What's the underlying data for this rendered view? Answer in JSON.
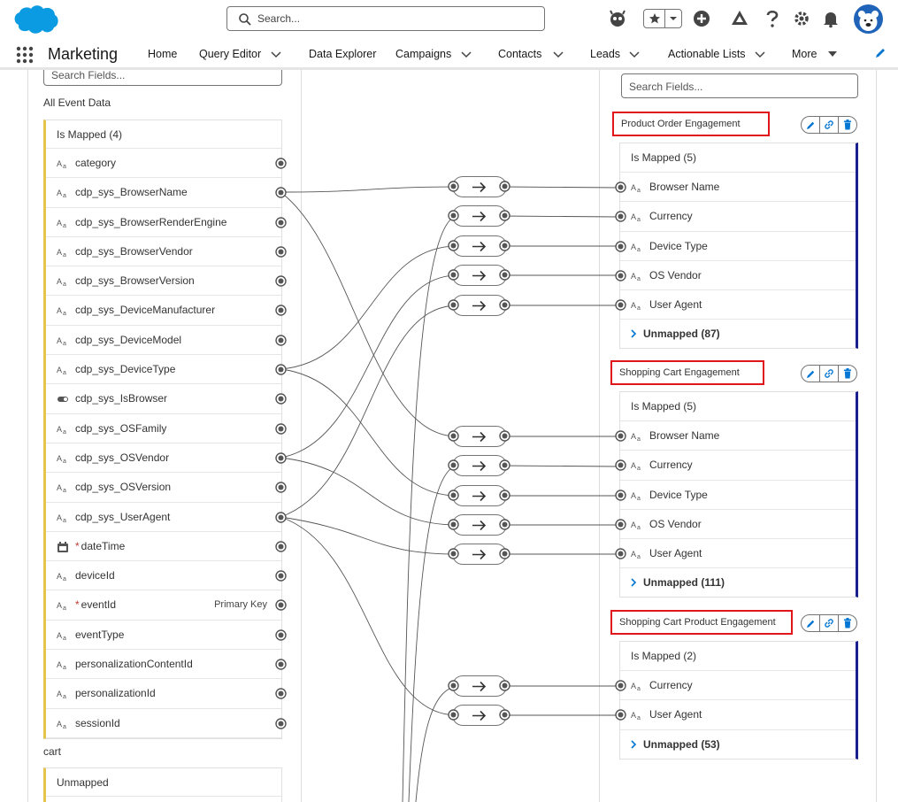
{
  "header": {
    "search_placeholder": "Search...",
    "brand_color": "#0b9be3"
  },
  "nav": {
    "app_name": "Marketing",
    "items": [
      {
        "label": "Home",
        "dropdown": false
      },
      {
        "label": "Query Editor",
        "dropdown": true
      },
      {
        "label": "Data Explorer",
        "dropdown": false
      },
      {
        "label": "Campaigns",
        "dropdown": true
      },
      {
        "label": "Contacts",
        "dropdown": true
      },
      {
        "label": "Leads",
        "dropdown": true
      },
      {
        "label": "Actionable Lists",
        "dropdown": true
      },
      {
        "label": "More",
        "dropdown": true
      }
    ]
  },
  "left": {
    "search_placeholder": "Search Fields...",
    "section_title": "All Event Data",
    "group_label": "Is Mapped (4)",
    "fields": [
      {
        "label": "category",
        "type": "text"
      },
      {
        "label": "cdp_sys_BrowserName",
        "type": "text"
      },
      {
        "label": "cdp_sys_BrowserRenderEngine",
        "type": "text"
      },
      {
        "label": "cdp_sys_BrowserVendor",
        "type": "text"
      },
      {
        "label": "cdp_sys_BrowserVersion",
        "type": "text"
      },
      {
        "label": "cdp_sys_DeviceManufacturer",
        "type": "text"
      },
      {
        "label": "cdp_sys_DeviceModel",
        "type": "text"
      },
      {
        "label": "cdp_sys_DeviceType",
        "type": "text"
      },
      {
        "label": "cdp_sys_IsBrowser",
        "type": "boolean"
      },
      {
        "label": "cdp_sys_OSFamily",
        "type": "text"
      },
      {
        "label": "cdp_sys_OSVendor",
        "type": "text"
      },
      {
        "label": "cdp_sys_OSVersion",
        "type": "text"
      },
      {
        "label": "cdp_sys_UserAgent",
        "type": "text"
      },
      {
        "label": "dateTime",
        "type": "date",
        "required": "*"
      },
      {
        "label": "deviceId",
        "type": "text"
      },
      {
        "label": "eventId",
        "type": "text",
        "required": "*",
        "badge": "Primary Key"
      },
      {
        "label": "eventType",
        "type": "text"
      },
      {
        "label": "personalizationContentId",
        "type": "text"
      },
      {
        "label": "personalizationId",
        "type": "text"
      },
      {
        "label": "sessionId",
        "type": "text"
      }
    ],
    "cart_section_title": "cart",
    "cart_group_label": "Unmapped"
  },
  "right": {
    "search_placeholder": "Search Fields...",
    "objects": [
      {
        "title": "Product Order Engagement",
        "mapped_label": "Is Mapped (5)",
        "fields": [
          "Browser Name",
          "Currency",
          "Device Type",
          "OS Vendor",
          "User Agent"
        ],
        "unmapped_label": "Unmapped (87)"
      },
      {
        "title": "Shopping Cart Engagement",
        "mapped_label": "Is Mapped (5)",
        "fields": [
          "Browser Name",
          "Currency",
          "Device Type",
          "OS Vendor",
          "User Agent"
        ],
        "unmapped_label": "Unmapped (111)"
      },
      {
        "title": "Shopping Cart Product Engagement",
        "mapped_label": "Is Mapped (2)",
        "fields": [
          "Currency",
          "User Agent"
        ],
        "unmapped_label": "Unmapped (53)"
      }
    ]
  },
  "icons": {
    "text_field": "Aa",
    "highlight_color": "#e0161a",
    "accent_color": "#0176d3"
  }
}
